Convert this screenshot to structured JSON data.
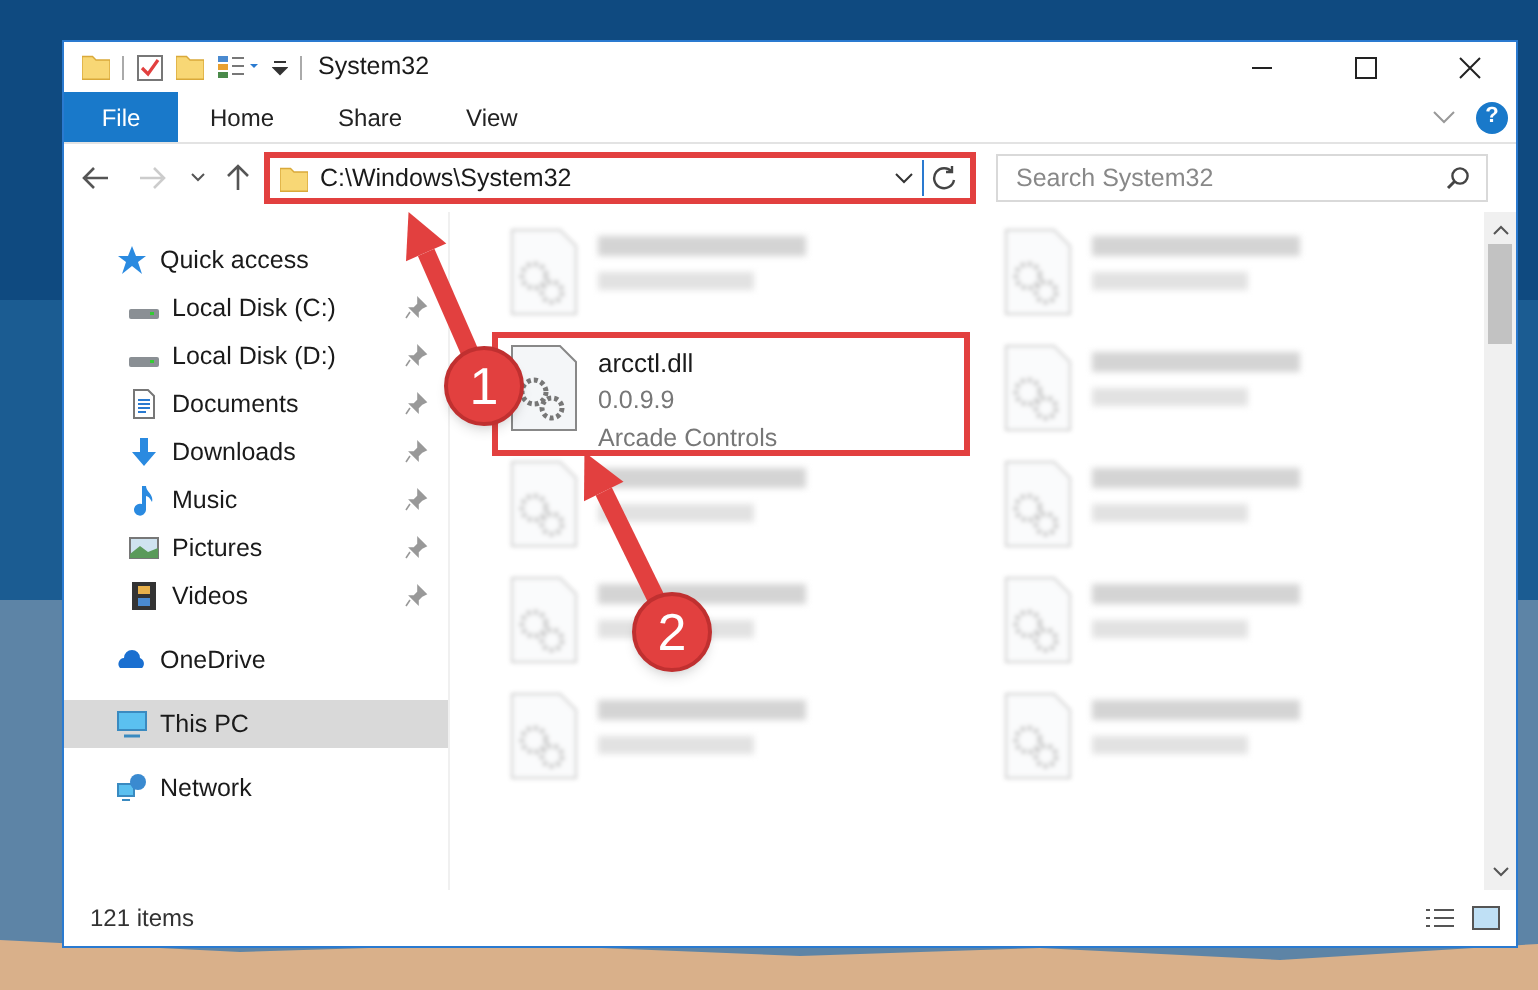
{
  "window": {
    "title": "System32"
  },
  "ribbon": {
    "tabs": [
      {
        "label": "File",
        "selected": true
      },
      {
        "label": "Home",
        "selected": false
      },
      {
        "label": "Share",
        "selected": false
      },
      {
        "label": "View",
        "selected": false
      }
    ],
    "help": "?"
  },
  "address_bar": {
    "path": "C:\\Windows\\System32",
    "highlighted": true
  },
  "search": {
    "placeholder": "Search System32"
  },
  "navigation": [
    {
      "label": "Quick access",
      "selected": false,
      "children": [
        {
          "label": "Local Disk (C:)",
          "pinned": true
        },
        {
          "label": "Local Disk (D:)",
          "pinned": true
        },
        {
          "label": "Documents",
          "pinned": true
        },
        {
          "label": "Downloads",
          "pinned": true
        },
        {
          "label": "Music",
          "pinned": true
        },
        {
          "label": "Pictures",
          "pinned": true
        },
        {
          "label": "Videos",
          "pinned": true
        }
      ]
    },
    {
      "label": "OneDrive",
      "selected": false
    },
    {
      "label": "This PC",
      "selected": true
    },
    {
      "label": "Network",
      "selected": false
    }
  ],
  "files": [
    {
      "kind": "blurred"
    },
    {
      "kind": "blurred"
    },
    {
      "kind": "file",
      "name": "arcctl.dll",
      "lines": [
        "0.0.9.9",
        "Arcade Controls"
      ],
      "highlighted": true
    },
    {
      "kind": "blurred"
    },
    {
      "kind": "blurred"
    },
    {
      "kind": "blurred"
    },
    {
      "kind": "blurred"
    },
    {
      "kind": "blurred"
    },
    {
      "kind": "blurred"
    },
    {
      "kind": "blurred"
    }
  ],
  "status_bar": {
    "items": "121 items"
  },
  "annotations": [
    {
      "label": "1"
    },
    {
      "label": "2"
    }
  ]
}
